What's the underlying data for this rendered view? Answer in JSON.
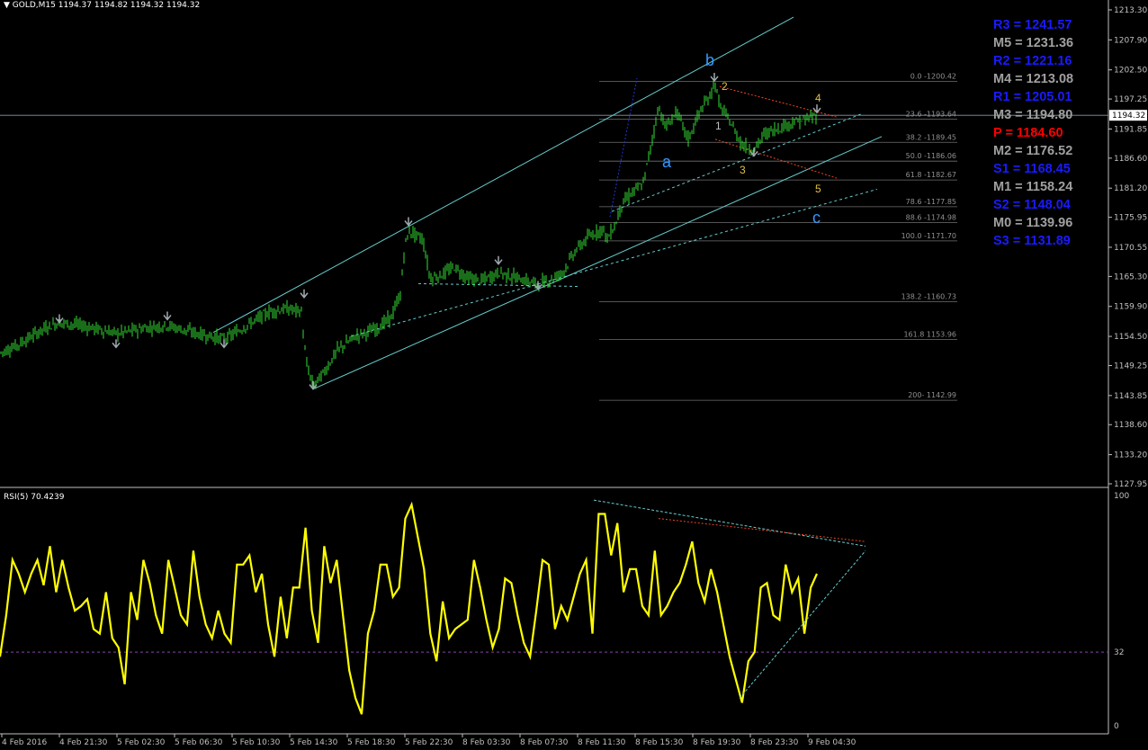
{
  "header": {
    "symbol_timeframe": "GOLD,M15",
    "ohlc": "1194.37 1194.82 1194.32 1194.32",
    "current_price": "1194.32"
  },
  "colors": {
    "background": "#000000",
    "candles": "#33dd33",
    "channel": "#66cccc",
    "grid_text": "#c0c0c0",
    "rsi_line": "#ffff00",
    "resistance": "#1a1aff",
    "pivot": "#ff0000",
    "mid": "#a0a0a0",
    "wave_label": "#3399ff",
    "sub_wave": "#e0c040"
  },
  "pivot_levels": [
    {
      "label": "R3 = 1241.57",
      "kind": "resistance"
    },
    {
      "label": "M5 = 1231.36",
      "kind": "mid"
    },
    {
      "label": "R2 = 1221.16",
      "kind": "resistance"
    },
    {
      "label": "M4 = 1213.08",
      "kind": "mid"
    },
    {
      "label": "R1 = 1205.01",
      "kind": "resistance"
    },
    {
      "label": "M3 = 1194.80",
      "kind": "mid"
    },
    {
      "label": "P   = 1184.60",
      "kind": "pivot"
    },
    {
      "label": "M2 = 1176.52",
      "kind": "mid"
    },
    {
      "label": "S1 = 1168.45",
      "kind": "resistance"
    },
    {
      "label": "M1 = 1158.24",
      "kind": "mid"
    },
    {
      "label": "S2 = 1148.04",
      "kind": "resistance"
    },
    {
      "label": "M0 = 1139.96",
      "kind": "mid"
    },
    {
      "label": "S3 = 1131.89",
      "kind": "resistance"
    }
  ],
  "chart_data": [
    {
      "type": "candlestick",
      "title": "GOLD,M15",
      "ylim": [
        1127.95,
        1213.3
      ],
      "y_ticks": [
        "1213.30",
        "1207.90",
        "1202.50",
        "1197.25",
        "1191.85",
        "1186.60",
        "1181.20",
        "1175.95",
        "1170.55",
        "1165.30",
        "1159.90",
        "1154.50",
        "1149.25",
        "1143.85",
        "1138.60",
        "1133.20",
        "1127.95"
      ],
      "x_ticks": [
        "4 Feb 2016",
        "4 Feb 21:30",
        "5 Feb 02:30",
        "5 Feb 06:30",
        "5 Feb 10:30",
        "5 Feb 14:30",
        "5 Feb 18:30",
        "5 Feb 22:30",
        "8 Feb 03:30",
        "8 Feb 07:30",
        "8 Feb 11:30",
        "8 Feb 15:30",
        "8 Feb 19:30",
        "8 Feb 23:30",
        "9 Feb 04:30"
      ],
      "price_path": [
        [
          0,
          1151.5
        ],
        [
          20,
          1153
        ],
        [
          50,
          1156
        ],
        [
          65,
          1157
        ],
        [
          90,
          1156.5
        ],
        [
          130,
          1155
        ],
        [
          160,
          1156
        ],
        [
          185,
          1156.5
        ],
        [
          220,
          1155
        ],
        [
          250,
          1154
        ],
        [
          270,
          1156
        ],
        [
          300,
          1159
        ],
        [
          320,
          1159.5
        ],
        [
          335,
          1159
        ],
        [
          340,
          1150
        ],
        [
          348,
          1145.5
        ],
        [
          360,
          1148
        ],
        [
          375,
          1152
        ],
        [
          395,
          1154.5
        ],
        [
          420,
          1156
        ],
        [
          435,
          1158
        ],
        [
          445,
          1162
        ],
        [
          450,
          1171
        ],
        [
          455,
          1173.5
        ],
        [
          470,
          1172
        ],
        [
          478,
          1165
        ],
        [
          490,
          1165.5
        ],
        [
          505,
          1167
        ],
        [
          520,
          1165
        ],
        [
          535,
          1164.5
        ],
        [
          555,
          1166
        ],
        [
          575,
          1165
        ],
        [
          595,
          1164
        ],
        [
          610,
          1164.5
        ],
        [
          625,
          1166
        ],
        [
          640,
          1170
        ],
        [
          655,
          1172.5
        ],
        [
          670,
          1174
        ],
        [
          675,
          1172
        ],
        [
          685,
          1175
        ],
        [
          690,
          1178
        ],
        [
          700,
          1180
        ],
        [
          715,
          1182
        ],
        [
          725,
          1190
        ],
        [
          732,
          1196
        ],
        [
          740,
          1192
        ],
        [
          752,
          1195
        ],
        [
          765,
          1190
        ],
        [
          778,
          1195
        ],
        [
          790,
          1198
        ],
        [
          794,
          1200.5
        ],
        [
          800,
          1196
        ],
        [
          812,
          1193
        ],
        [
          825,
          1189
        ],
        [
          838,
          1188
        ],
        [
          850,
          1191
        ],
        [
          865,
          1192
        ],
        [
          880,
          1193
        ],
        [
          895,
          1193.5
        ],
        [
          908,
          1194.3
        ]
      ],
      "fibonacci": [
        {
          "level": "0.0",
          "price": "1200.42",
          "label": "0.0 -1200.42"
        },
        {
          "level": "23.6",
          "price": "1193.64",
          "label": "23.6 -1193.64"
        },
        {
          "level": "38.2",
          "price": "1189.45",
          "label": "38.2 -1189.45"
        },
        {
          "level": "50.0",
          "price": "1186.06",
          "label": "50.0 -1186.06"
        },
        {
          "level": "61.8",
          "price": "1182.67",
          "label": "61.8 -1182.67"
        },
        {
          "level": "78.6",
          "price": "1177.85",
          "label": "78.6 -1177.85"
        },
        {
          "level": "88.6",
          "price": "1174.98",
          "label": "88.6 -1174.98"
        },
        {
          "level": "100.0",
          "price": "1171.70",
          "label": "100.0 -1171.70"
        },
        {
          "level": "138.2",
          "price": "1160.73",
          "label": "138.2 -1160.73"
        },
        {
          "level": "161.8",
          "price": "1153.96",
          "label": "161.8 1153.96"
        },
        {
          "level": "200",
          "price": "1142.99",
          "label": "200- 1142.99"
        }
      ],
      "wave_labels": [
        "a",
        "b",
        "c"
      ],
      "sub_wave_labels": [
        "1",
        "2",
        "3",
        "4",
        "5"
      ]
    },
    {
      "type": "line",
      "title": "RSI(5) 70.4239",
      "ylim": [
        0,
        100
      ],
      "y_ticks": [
        "100",
        "32",
        "0"
      ],
      "level_line": 32,
      "series": [
        {
          "name": "RSI(5)",
          "values": [
            30,
            48,
            72,
            66,
            58,
            66,
            72,
            61,
            78,
            58,
            72,
            60,
            50,
            52,
            55,
            42,
            40,
            58,
            38,
            34,
            18,
            58,
            46,
            72,
            62,
            48,
            40,
            72,
            60,
            48,
            44,
            76,
            56,
            44,
            38,
            50,
            40,
            36,
            70,
            70,
            74,
            58,
            66,
            44,
            30,
            56,
            38,
            60,
            60,
            86,
            50,
            36,
            78,
            62,
            72,
            48,
            24,
            12,
            5,
            40,
            50,
            70,
            70,
            56,
            60,
            90,
            96,
            82,
            68,
            40,
            28,
            54,
            38,
            42,
            44,
            46,
            72,
            60,
            46,
            34,
            42,
            64,
            62,
            48,
            36,
            30,
            50,
            72,
            70,
            42,
            52,
            46,
            56,
            66,
            72,
            40,
            92,
            92,
            74,
            88,
            58,
            68,
            68,
            52,
            48,
            76,
            48,
            52,
            58,
            62,
            70,
            80,
            62,
            54,
            68,
            58,
            44,
            30,
            20,
            10,
            28,
            32,
            60,
            62,
            48,
            46,
            70,
            58,
            64,
            40,
            60,
            66
          ]
        }
      ]
    }
  ]
}
